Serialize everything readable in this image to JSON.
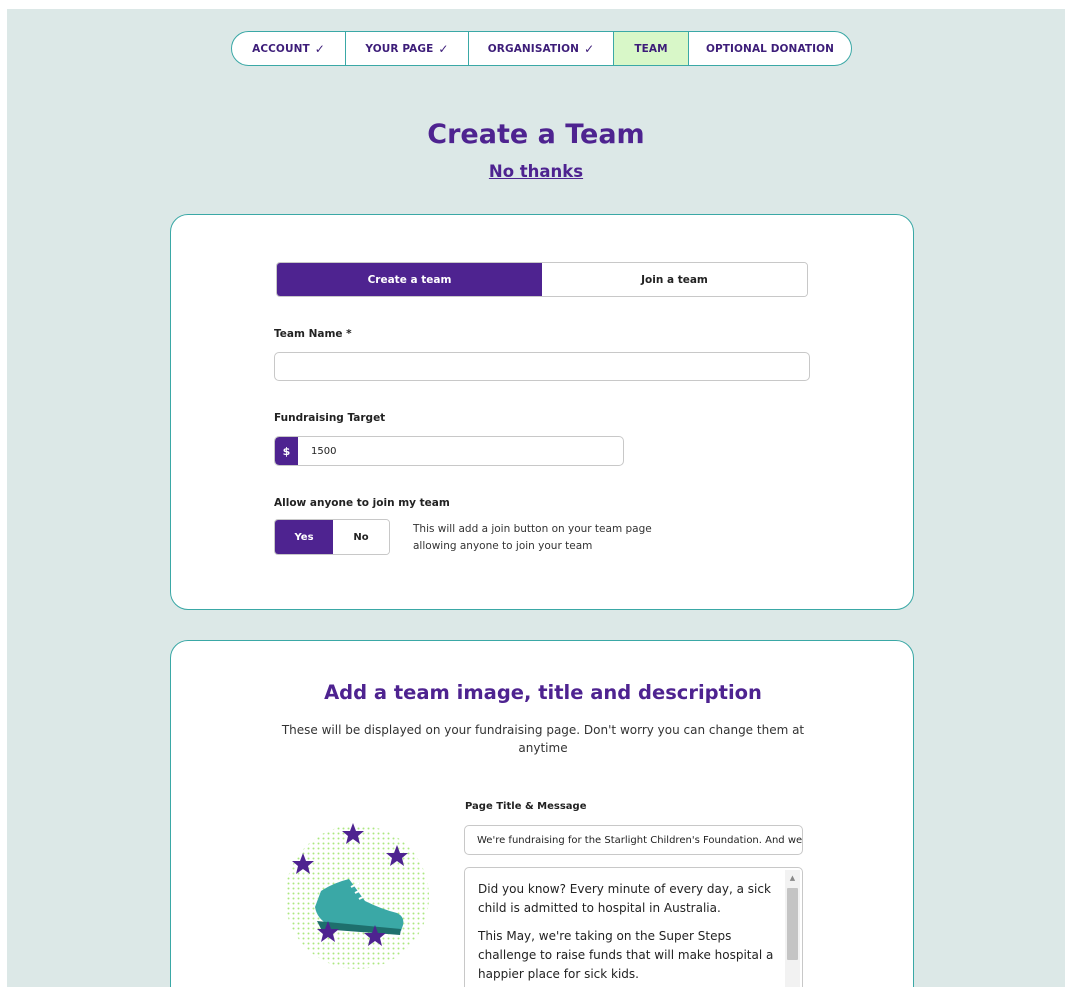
{
  "stepper": {
    "steps": [
      {
        "label": "ACCOUNT",
        "check": "✓"
      },
      {
        "label": "YOUR PAGE",
        "check": "✓"
      },
      {
        "label": "ORGANISATION",
        "check": "✓"
      },
      {
        "label": "TEAM",
        "check": ""
      },
      {
        "label": "OPTIONAL DONATION",
        "check": ""
      }
    ],
    "active_step": "TEAM"
  },
  "header": {
    "title": "Create a Team",
    "skip_link": "No thanks"
  },
  "team_form": {
    "toggle": {
      "create_label": "Create a team",
      "join_label": "Join a team",
      "selected": "Create a team"
    },
    "team_name_label": "Team Name *",
    "team_name_value": "",
    "target_label": "Fundraising Target",
    "currency_symbol": "$",
    "target_value": "1500",
    "allow_join_label": "Allow anyone to join my team",
    "yes_label": "Yes",
    "no_label": "No",
    "allow_join_selected": "Yes",
    "allow_join_hint": "This will add a join button on your team page allowing anyone to join your team"
  },
  "team_details": {
    "title": "Add a team image, title and description",
    "subtitle": "These will be displayed on your fundraising page. Don't worry you can change them at anytime",
    "page_title_label": "Page Title & Message",
    "page_title_value": "We're fundraising for the Starlight Children's Foundation. And we",
    "message_paragraphs": [
      "Did you know? Every minute of every day, a sick child is admitted to hospital in Australia.",
      "This May, we're taking on the Super Steps challenge to raise funds that will make hospital a happier place for sick kids."
    ],
    "image_icon": "sneaker-with-stars-icon"
  },
  "colors": {
    "brand_purple": "#4e2390",
    "accent_teal": "#3aa8a6",
    "active_step_green": "#d8f7c8",
    "background": "#dce8e7"
  }
}
